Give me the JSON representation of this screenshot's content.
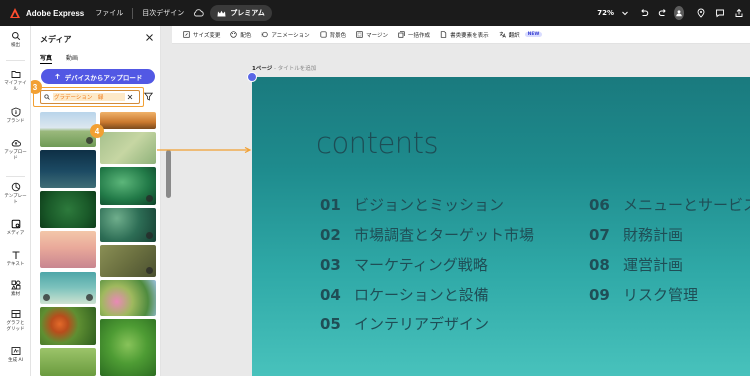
{
  "topbar": {
    "brand": "Adobe Express",
    "file_menu": "ファイル",
    "doc_size": "目次デザイン",
    "premium": "プレミアム",
    "zoom": "72%"
  },
  "rail": {
    "items": [
      {
        "label": "検出",
        "icon": "search-icon"
      },
      {
        "label": "マイファイ\nル",
        "icon": "folder-icon"
      },
      {
        "label": "ブランド",
        "icon": "brand-icon"
      },
      {
        "label": "アップロー\nド",
        "icon": "upload-icon"
      },
      {
        "label": "テンプレー\nト",
        "icon": "template-icon"
      },
      {
        "label": "メディア",
        "icon": "media-icon"
      },
      {
        "label": "テキスト",
        "icon": "text-icon"
      },
      {
        "label": "素材",
        "icon": "elements-icon"
      },
      {
        "label": "グラフと\nグリッド",
        "icon": "grid-icon"
      },
      {
        "label": "生成 AI",
        "icon": "ai-icon"
      }
    ]
  },
  "panel": {
    "title": "メディア",
    "tabs": [
      "写真",
      "動画"
    ],
    "upload_button": "デバイスからアップロード",
    "search_value": "グラデーション　緑",
    "step3": "3",
    "step4": "4"
  },
  "toolbar": {
    "items": [
      "サイズ変更",
      "配色",
      "アニメーション",
      "背景色",
      "マージン",
      "一括作成",
      "書类要素を表示",
      "翻訳"
    ],
    "new_badge": "NEW"
  },
  "canvas": {
    "page_label": "1ページ",
    "page_sub": " - タイトルを追加",
    "title": "contents",
    "toc_left": [
      {
        "num": "01",
        "text": "ビジョンとミッション"
      },
      {
        "num": "02",
        "text": "市場調査とターゲット市場"
      },
      {
        "num": "03",
        "text": "マーケティング戦略"
      },
      {
        "num": "04",
        "text": "ロケーションと設備"
      },
      {
        "num": "05",
        "text": "インテリアデザイン"
      }
    ],
    "toc_right": [
      {
        "num": "06",
        "text": "メニューとサービス"
      },
      {
        "num": "07",
        "text": "財務計画"
      },
      {
        "num": "08",
        "text": "運営計画"
      },
      {
        "num": "09",
        "text": "リスク管理"
      }
    ]
  },
  "colors": {
    "accent": "#5258e4",
    "highlight": "#f2a033",
    "slide_top": "#1a7a7e",
    "slide_bottom": "#48c2bc"
  }
}
